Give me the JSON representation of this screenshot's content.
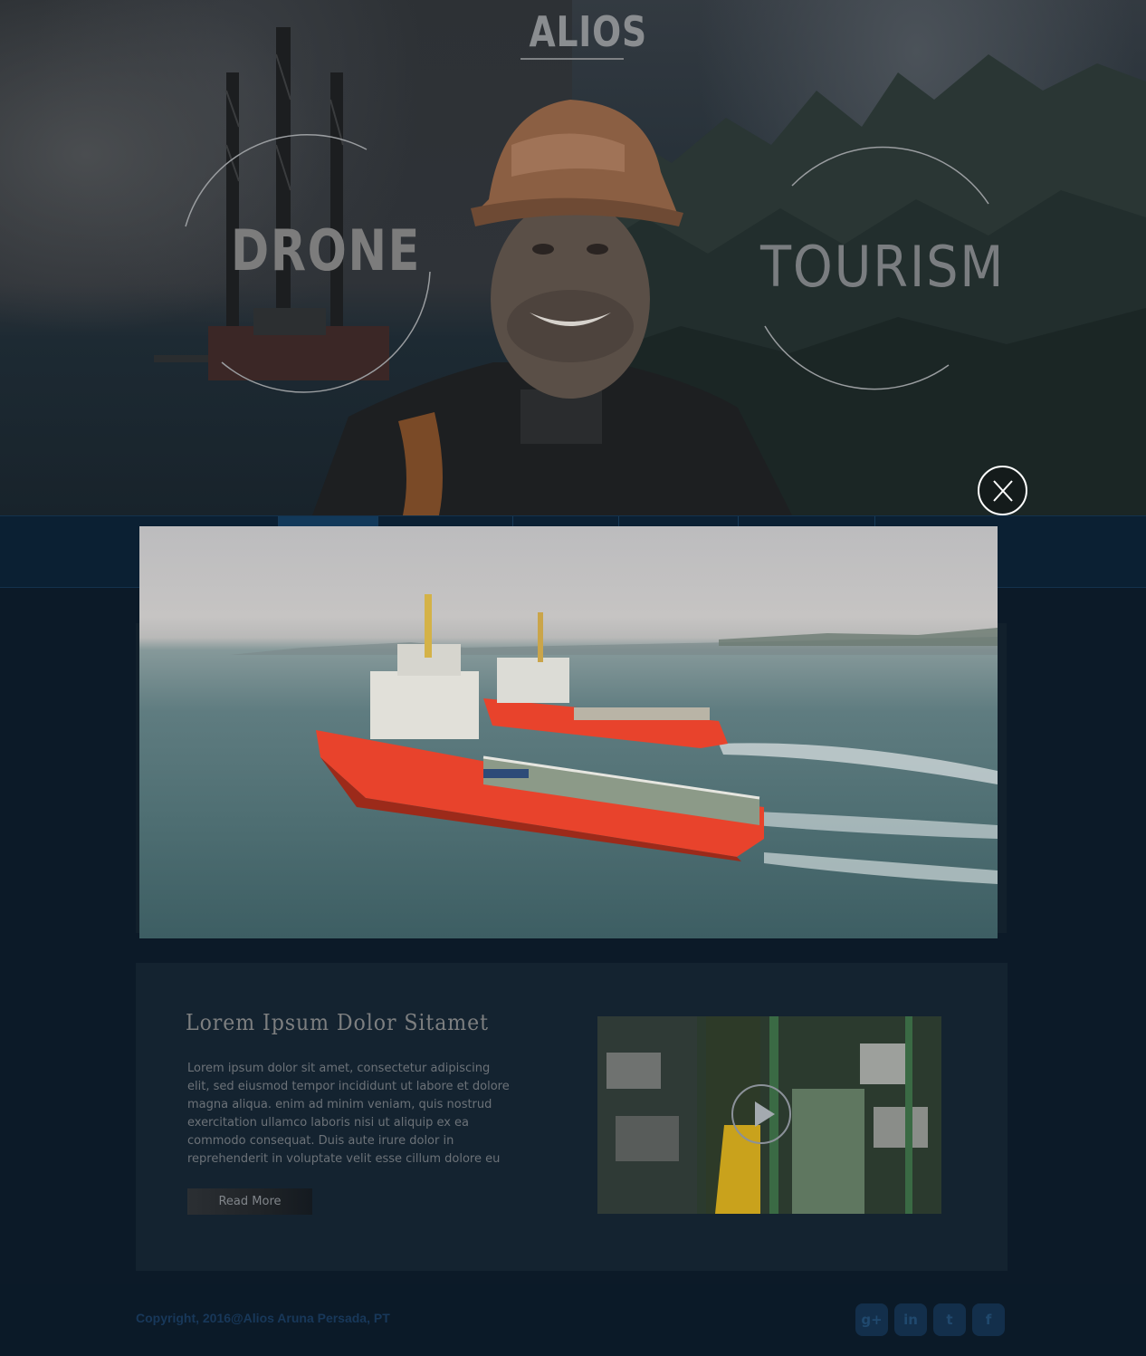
{
  "hero": {
    "brand": "ALIOS",
    "left_label": "DRONE",
    "right_label": "TOURISM",
    "close_label": "X"
  },
  "video": {
    "description": "Aerial drone footage of two offshore supply vessels"
  },
  "article": {
    "title": "Lorem  Ipsum Dolor Sitamet",
    "body": "Lorem ipsum dolor sit amet, consectetur adipiscing elit, sed  eiusmod tempor incididunt ut labore et dolore magna aliqua.  enim ad minim veniam, quis nostrud exercitation ullamco laboris nisi ut aliquip ex ea commodo consequat. Duis aute irure dolor in reprehenderit in voluptate velit esse cillum dolore eu",
    "read_more": "Read More"
  },
  "footer": {
    "copyright": "Copyright, 2016@Alios Aruna Persada, PT",
    "social": [
      {
        "icon": "google-plus-icon",
        "glyph": "g+"
      },
      {
        "icon": "linkedin-icon",
        "glyph": "in"
      },
      {
        "icon": "twitter-icon",
        "glyph": "t"
      },
      {
        "icon": "facebook-icon",
        "glyph": "f"
      }
    ]
  },
  "colors": {
    "background": "#0c1a28",
    "navbar": "#0b2033",
    "card": "#142330",
    "vessel_hull": "#e8432c"
  }
}
